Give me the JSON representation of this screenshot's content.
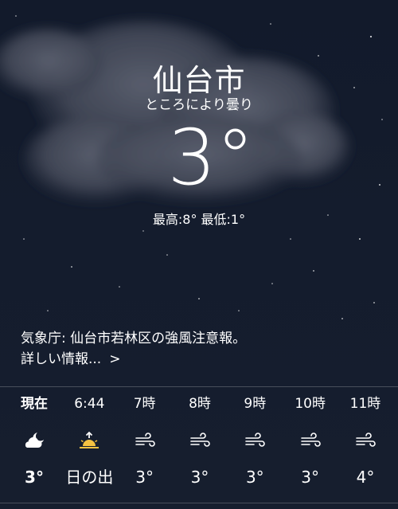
{
  "location": {
    "city": "仙台市",
    "condition": "ところにより曇り",
    "temperature": "3°",
    "hilo": "最高:8° 最低:1°"
  },
  "alert": {
    "text": "気象庁: 仙台市若林区の強風注意報。",
    "more_label": "詳しい情報...",
    "more_chevron": ">"
  },
  "hourly": [
    {
      "label": "現在",
      "icon": "partly-cloudy-night-icon",
      "temp": "3°"
    },
    {
      "label": "6:44",
      "icon": "sunrise-icon",
      "temp": "日の出"
    },
    {
      "label": "7時",
      "icon": "wind-icon",
      "temp": "3°"
    },
    {
      "label": "8時",
      "icon": "wind-icon",
      "temp": "3°"
    },
    {
      "label": "9時",
      "icon": "wind-icon",
      "temp": "3°"
    },
    {
      "label": "10時",
      "icon": "wind-icon",
      "temp": "3°"
    },
    {
      "label": "11時",
      "icon": "wind-icon",
      "temp": "4°"
    }
  ],
  "colors": {
    "background": "#131b2c",
    "sunrise": "#f5c242"
  }
}
